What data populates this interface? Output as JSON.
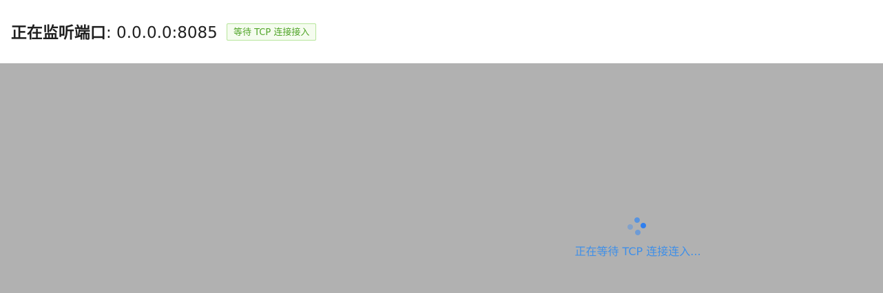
{
  "header": {
    "title_label": "正在监听端口",
    "title_value": ": 0.0.0.0:8085",
    "status_tag": "等待 TCP 连接接入"
  },
  "main": {
    "loading_text": "正在等待 TCP 连接连入..."
  },
  "colors": {
    "tag_text": "#52a52a",
    "tag_border": "#b6e59a",
    "overlay_bg": "#b1b1b1",
    "accent_blue": "#3f8fe8"
  }
}
